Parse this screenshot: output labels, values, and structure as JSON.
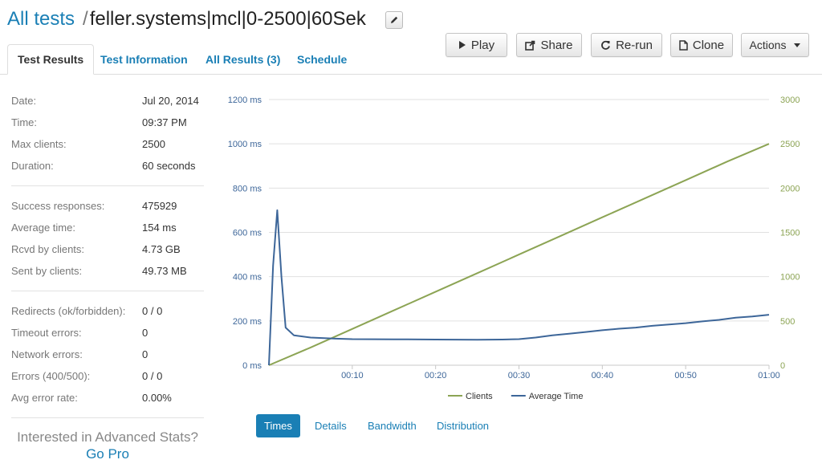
{
  "breadcrumb": {
    "root_label": "All tests",
    "separator": "/",
    "test_name": "feller.systems|mcl|0-2500|60Sek"
  },
  "toolbar": {
    "play_label": "Play",
    "share_label": "Share",
    "rerun_label": "Re-run",
    "clone_label": "Clone",
    "actions_label": "Actions"
  },
  "tabs": [
    {
      "label": "Test Results",
      "active": true
    },
    {
      "label": "Test Information",
      "active": false
    },
    {
      "label": "All Results (3)",
      "active": false
    },
    {
      "label": "Schedule",
      "active": false
    }
  ],
  "stats": {
    "group1": [
      {
        "key": "Date:",
        "value": "Jul 20, 2014"
      },
      {
        "key": "Time:",
        "value": "09:37 PM"
      },
      {
        "key": "Max clients:",
        "value": "2500"
      },
      {
        "key": "Duration:",
        "value": "60 seconds"
      }
    ],
    "group2": [
      {
        "key": "Success responses:",
        "value": "475929"
      },
      {
        "key": "Average time:",
        "value": "154 ms"
      },
      {
        "key": "Rcvd by clients:",
        "value": "4.73 GB"
      },
      {
        "key": "Sent by clients:",
        "value": "49.73 MB"
      }
    ],
    "group3": [
      {
        "key": "Redirects (ok/forbidden):",
        "value": "0 / 0"
      },
      {
        "key": "Timeout errors:",
        "value": "0"
      },
      {
        "key": "Network errors:",
        "value": "0"
      },
      {
        "key": "Errors (400/500):",
        "value": "0 / 0"
      },
      {
        "key": "Avg error rate:",
        "value": "0.00%"
      }
    ]
  },
  "promo": {
    "text": "Interested in Advanced Stats?",
    "link": "Go Pro"
  },
  "chart_data": {
    "type": "line",
    "x_ticks": [
      "00:10",
      "00:20",
      "00:30",
      "00:40",
      "00:50",
      "01:00"
    ],
    "y_left_ticks": [
      "0 ms",
      "200 ms",
      "400 ms",
      "600 ms",
      "800 ms",
      "1000 ms",
      "1200 ms"
    ],
    "y_right_ticks": [
      "0",
      "500",
      "1000",
      "1500",
      "2000",
      "2500",
      "3000"
    ],
    "y_left_range": [
      0,
      1200
    ],
    "y_right_range": [
      0,
      3000
    ],
    "x_range_seconds": [
      0,
      60
    ],
    "grid": true,
    "legend_position": "bottom",
    "series": [
      {
        "name": "Clients",
        "axis": "right",
        "color": "#8ca454",
        "x": [
          0,
          5,
          10,
          15,
          20,
          25,
          30,
          35,
          40,
          45,
          50,
          55,
          60
        ],
        "values": [
          0,
          200,
          410,
          620,
          830,
          1040,
          1250,
          1460,
          1670,
          1880,
          2090,
          2300,
          2500
        ]
      },
      {
        "name": "Average Time",
        "axis": "left",
        "color": "#3d6699",
        "x": [
          0,
          0.5,
          1,
          1.5,
          2,
          3,
          5,
          8,
          10,
          15,
          20,
          25,
          28,
          30,
          32,
          34,
          36,
          38,
          40,
          42,
          44,
          46,
          48,
          50,
          52,
          54,
          56,
          58,
          60
        ],
        "values": [
          0,
          450,
          700,
          400,
          170,
          135,
          125,
          120,
          118,
          117,
          116,
          115,
          116,
          118,
          125,
          135,
          142,
          150,
          158,
          165,
          170,
          178,
          184,
          190,
          198,
          205,
          215,
          220,
          228
        ]
      }
    ]
  },
  "subtabs": [
    {
      "label": "Times",
      "active": true
    },
    {
      "label": "Details",
      "active": false
    },
    {
      "label": "Bandwidth",
      "active": false
    },
    {
      "label": "Distribution",
      "active": false
    }
  ],
  "colors": {
    "link": "#1a7fb5",
    "clients": "#8ca454",
    "average_time": "#3d6699"
  }
}
